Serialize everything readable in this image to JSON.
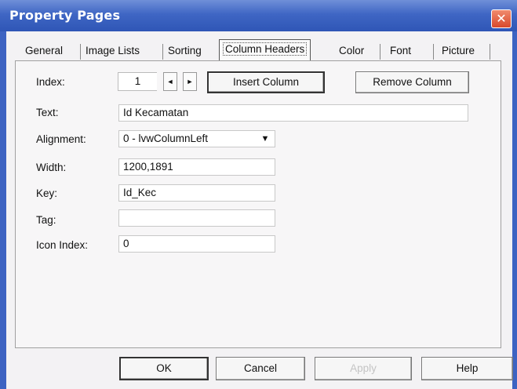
{
  "window": {
    "title": "Property Pages",
    "close_glyph": "✕"
  },
  "tabs": [
    {
      "label": "General"
    },
    {
      "label": "Image Lists"
    },
    {
      "label": "Sorting"
    },
    {
      "label": "Column Headers"
    },
    {
      "label": "Color"
    },
    {
      "label": "Font"
    },
    {
      "label": "Picture"
    }
  ],
  "active_tab": "Column Headers",
  "form": {
    "index": {
      "label": "Index:",
      "value": "1",
      "prev": "◄",
      "next": "►"
    },
    "text": {
      "label": "Text:",
      "value": "Id Kecamatan"
    },
    "alignment": {
      "label": "Alignment:",
      "value": "0 - lvwColumnLeft",
      "arrow": "▼"
    },
    "width": {
      "label": "Width:",
      "value": "1200,1891"
    },
    "key": {
      "label": "Key:",
      "value": "Id_Kec"
    },
    "tag": {
      "label": "Tag:",
      "value": ""
    },
    "icon_index": {
      "label": "Icon Index:",
      "value": "0"
    }
  },
  "buttons": {
    "insert_column": "Insert Column",
    "remove_column": "Remove Column",
    "ok": "OK",
    "cancel": "Cancel",
    "apply": "Apply",
    "help": "Help"
  },
  "colors": {
    "titlebar": "#3f66c4",
    "close": "#d8482b"
  }
}
